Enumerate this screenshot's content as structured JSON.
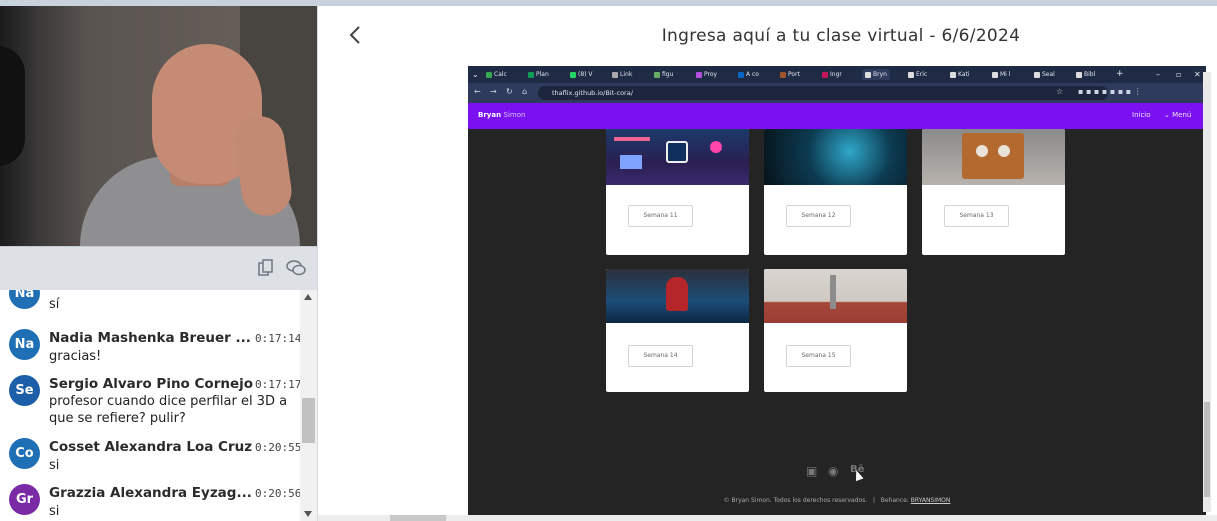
{
  "chat": {
    "messages": [
      {
        "initials": "Na",
        "name": "",
        "time": "",
        "text": "sí",
        "color": "#1f6fb5"
      },
      {
        "initials": "Na",
        "name": "Nadia Mashenka Breuer ...",
        "time": "0:17:14",
        "text": "gracias!",
        "color": "#1f6fb5"
      },
      {
        "initials": "Se",
        "name": "Sergio Alvaro Pino Cornejo",
        "time": "0:17:17",
        "text": "profesor cuando dice perfilar el 3D a que se refiere? pulir?",
        "color": "#1d5ea8"
      },
      {
        "initials": "Co",
        "name": "Cosset Alexandra Loa Cruz",
        "time": "0:20:55",
        "text": "si",
        "color": "#1f6fb5"
      },
      {
        "initials": "Gr",
        "name": "Grazzia Alexandra Eyzag...",
        "time": "0:20:56",
        "text": "si",
        "color": "#7b2aa6"
      }
    ]
  },
  "video_toolbar": {
    "copy_icon": "copy-icon",
    "chat_icon": "chat-bubbles-icon"
  },
  "session": {
    "title": "Ingresa aquí a tu clase virtual - 6/6/2024",
    "back_icon": "chevron-left-icon"
  },
  "shared_screen": {
    "tabs": [
      "Calc",
      "Plan",
      "(8) V",
      "Link",
      "figu",
      "Proy",
      "A co",
      "Port",
      "Ingr",
      "Bryn",
      "Eric",
      "Kati",
      "Mi l",
      "Seal",
      "Bibl"
    ],
    "active_tab_index": 9,
    "url": "thaflix.github.io/Bit-cora/",
    "site": {
      "brand_bold": "Bryan",
      "brand_thin": "Simon",
      "nav_home": "Inicio",
      "nav_menu": "Menú",
      "cards": [
        {
          "label": "Semana 11"
        },
        {
          "label": "Semana 12"
        },
        {
          "label": "Semana 13"
        },
        {
          "label": "Semana 14"
        },
        {
          "label": "Semana 15"
        }
      ],
      "footer_icons": [
        "linkedin-icon",
        "github-icon",
        "behance-icon"
      ],
      "copyright": "© Bryan Simon. Todos los derechos reservados.",
      "separator": "|",
      "behance_prefix": "Behance:",
      "behance_link": "BRYANSIMON"
    }
  }
}
